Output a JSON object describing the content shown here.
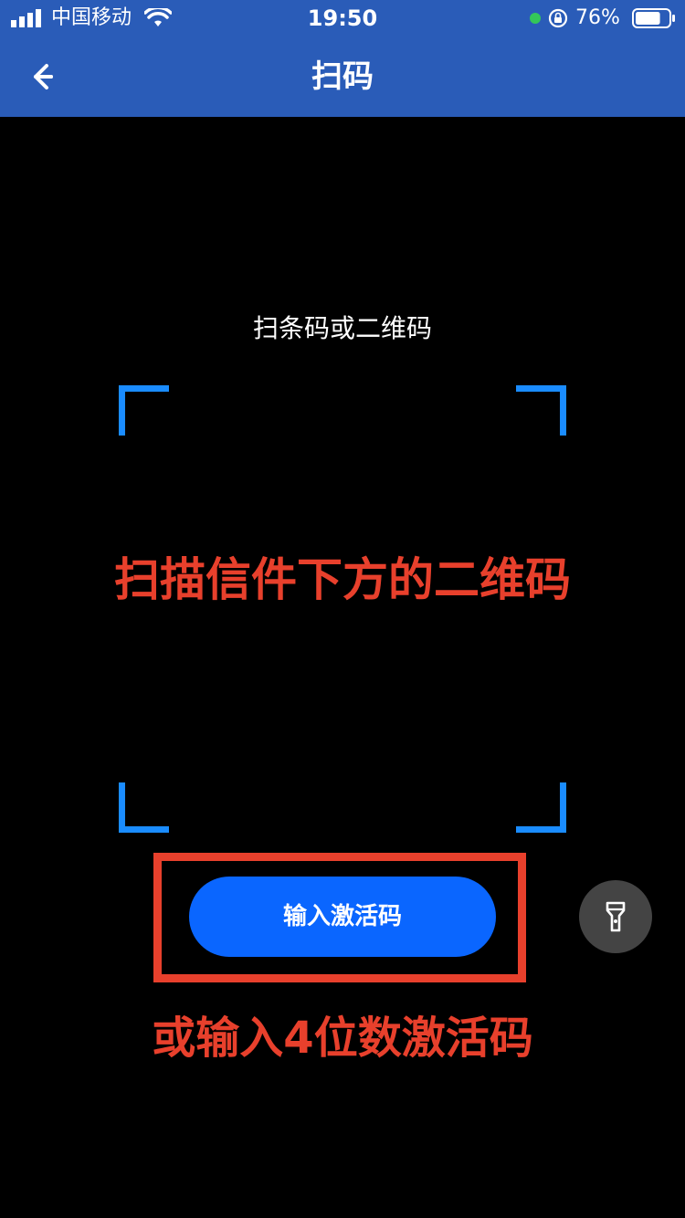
{
  "status_bar": {
    "carrier": "中国移动",
    "time": "19:50",
    "battery_percent": "76%",
    "battery_level": 0.76,
    "icons": [
      "signal-icon",
      "wifi-icon",
      "green-dot-indicator",
      "orientation-lock-icon",
      "battery-icon"
    ]
  },
  "nav": {
    "title": "扫码",
    "back_icon": "arrow-left-icon"
  },
  "scanner": {
    "hint": "扫条码或二维码",
    "frame_color": "#1a8cff"
  },
  "overlay": {
    "instruction": "扫描信件下方的二维码",
    "alternative": "或输入4位数激活码",
    "color": "#e8402c"
  },
  "actions": {
    "activate_label": "输入激活码",
    "activate_color": "#0a66ff",
    "flashlight_icon": "flashlight-icon"
  },
  "colors": {
    "header_blue": "#2a5cb8",
    "background": "#000000"
  }
}
